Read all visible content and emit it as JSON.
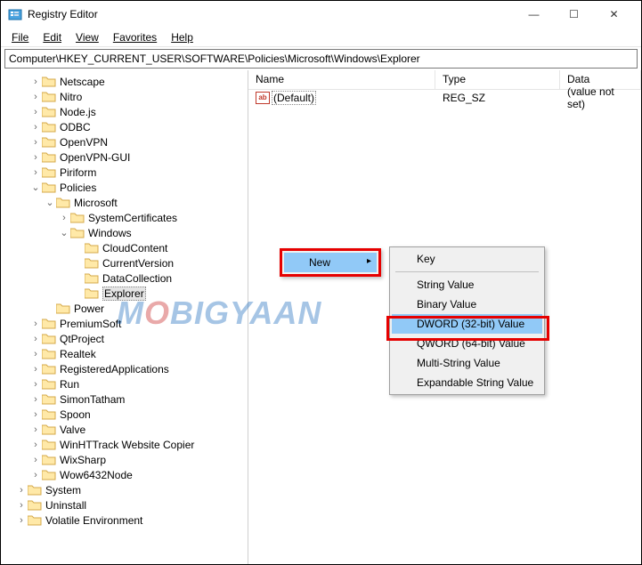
{
  "window": {
    "title": "Registry Editor",
    "min": "—",
    "max": "☐",
    "close": "✕"
  },
  "menubar": [
    "File",
    "Edit",
    "View",
    "Favorites",
    "Help"
  ],
  "address": "Computer\\HKEY_CURRENT_USER\\SOFTWARE\\Policies\\Microsoft\\Windows\\Explorer",
  "tree": [
    {
      "indent": 2,
      "exp": ">",
      "label": "Netscape"
    },
    {
      "indent": 2,
      "exp": ">",
      "label": "Nitro"
    },
    {
      "indent": 2,
      "exp": ">",
      "label": "Node.js"
    },
    {
      "indent": 2,
      "exp": ">",
      "label": "ODBC"
    },
    {
      "indent": 2,
      "exp": ">",
      "label": "OpenVPN"
    },
    {
      "indent": 2,
      "exp": ">",
      "label": "OpenVPN-GUI"
    },
    {
      "indent": 2,
      "exp": ">",
      "label": "Piriform"
    },
    {
      "indent": 2,
      "exp": "v",
      "label": "Policies"
    },
    {
      "indent": 3,
      "exp": "v",
      "label": "Microsoft"
    },
    {
      "indent": 4,
      "exp": ">",
      "label": "SystemCertificates"
    },
    {
      "indent": 4,
      "exp": "v",
      "label": "Windows"
    },
    {
      "indent": 5,
      "exp": "",
      "label": "CloudContent"
    },
    {
      "indent": 5,
      "exp": "",
      "label": "CurrentVersion"
    },
    {
      "indent": 5,
      "exp": "",
      "label": "DataCollection"
    },
    {
      "indent": 5,
      "exp": "",
      "label": "Explorer",
      "selected": true
    },
    {
      "indent": 3,
      "exp": "",
      "label": "Power"
    },
    {
      "indent": 2,
      "exp": ">",
      "label": "PremiumSoft"
    },
    {
      "indent": 2,
      "exp": ">",
      "label": "QtProject"
    },
    {
      "indent": 2,
      "exp": ">",
      "label": "Realtek"
    },
    {
      "indent": 2,
      "exp": ">",
      "label": "RegisteredApplications"
    },
    {
      "indent": 2,
      "exp": ">",
      "label": "Run"
    },
    {
      "indent": 2,
      "exp": ">",
      "label": "SimonTatham"
    },
    {
      "indent": 2,
      "exp": ">",
      "label": "Spoon"
    },
    {
      "indent": 2,
      "exp": ">",
      "label": "Valve"
    },
    {
      "indent": 2,
      "exp": ">",
      "label": "WinHTTrack Website Copier"
    },
    {
      "indent": 2,
      "exp": ">",
      "label": "WixSharp"
    },
    {
      "indent": 2,
      "exp": ">",
      "label": "Wow6432Node"
    },
    {
      "indent": 1,
      "exp": ">",
      "label": "System"
    },
    {
      "indent": 1,
      "exp": ">",
      "label": "Uninstall"
    },
    {
      "indent": 1,
      "exp": ">",
      "label": "Volatile Environment"
    }
  ],
  "list": {
    "headers": {
      "name": "Name",
      "type": "Type",
      "data": "Data"
    },
    "rows": [
      {
        "icon": "ab",
        "name": "(Default)",
        "type": "REG_SZ",
        "data": "(value not set)"
      }
    ]
  },
  "context_menu_main": {
    "new_label": "New",
    "arrow": "▸"
  },
  "context_submenu": [
    {
      "label": "Key"
    },
    {
      "sep": true
    },
    {
      "label": "String Value"
    },
    {
      "label": "Binary Value"
    },
    {
      "label": "DWORD (32-bit) Value",
      "highlight": true
    },
    {
      "label": "QWORD (64-bit) Value"
    },
    {
      "label": "Multi-String Value"
    },
    {
      "label": "Expandable String Value"
    }
  ],
  "watermark": "MOBIGYAAN"
}
